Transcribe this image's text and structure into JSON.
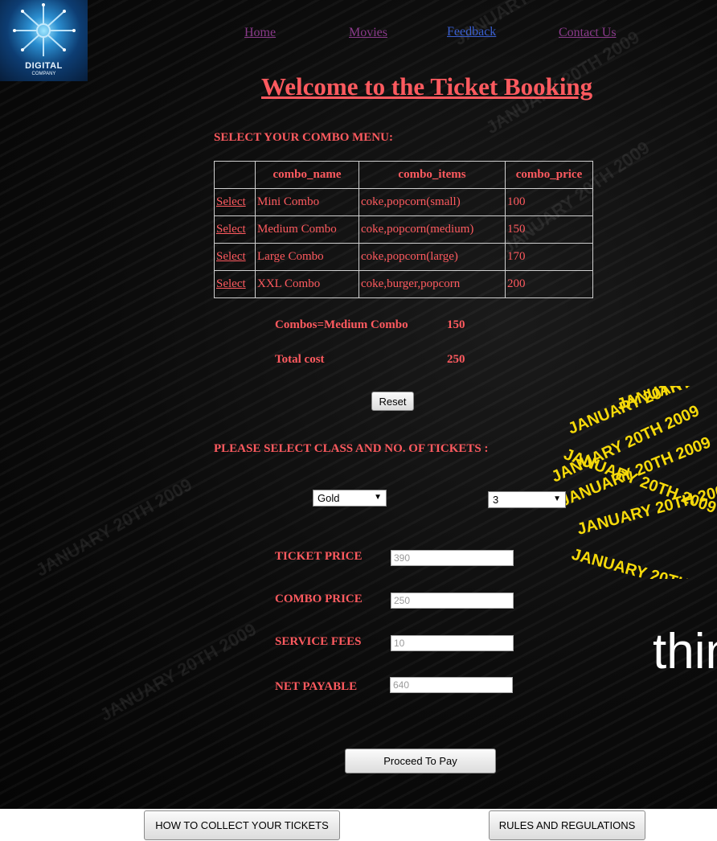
{
  "logo": {
    "title": "DIGITAL",
    "subtitle": "COMPANY"
  },
  "nav": {
    "items": [
      {
        "label": "Home",
        "color": "#8a3a8a"
      },
      {
        "label": "Movies",
        "color": "#8a3a8a"
      },
      {
        "label": "Feedback",
        "color": "#3a5fd0"
      },
      {
        "label": "Contact Us",
        "color": "#8a3a8a"
      }
    ]
  },
  "page_title": "Welcome to the Ticket Booking",
  "combo_section": {
    "heading": "SELECT YOUR COMBO MENU:",
    "columns": [
      "",
      "combo_name",
      "combo_items",
      "combo_price"
    ],
    "rows": [
      {
        "action": "Select",
        "name": "Mini Combo",
        "items": "coke,popcorn(small)",
        "price": "100"
      },
      {
        "action": "Select",
        "name": "Medium Combo",
        "items": "coke,popcorn(medium)",
        "price": "150"
      },
      {
        "action": "Select",
        "name": "Large Combo",
        "items": "coke,popcorn(large)",
        "price": "170"
      },
      {
        "action": "Select",
        "name": "XXL Combo",
        "items": "coke,burger,popcorn",
        "price": "200"
      }
    ]
  },
  "summary": {
    "combos_label": "Combos=Medium Combo",
    "combos_value": "150",
    "total_label": "Total cost",
    "total_value": "250",
    "reset_label": "Reset"
  },
  "ticket_section": {
    "heading": "PLEASE SELECT CLASS AND NO. OF TICKETS :",
    "class_selected": "Gold",
    "count_selected": "3"
  },
  "pricing": {
    "ticket_price_label": "TICKET PRICE",
    "ticket_price_value": "390",
    "combo_price_label": "COMBO PRICE",
    "combo_price_value": "250",
    "service_fees_label": "SERVICE FEES",
    "service_fees_value": "10",
    "net_payable_label": "NET PAYABLE",
    "net_payable_value": "640"
  },
  "proceed_label": "Proceed To Pay",
  "footer": {
    "collect_label": "HOW TO COLLECT YOUR TICKETS",
    "rules_label": "RULES AND REGULATIONS"
  },
  "background": {
    "pattern_text": "JANUARY 20TH 2009",
    "big_word": "thin",
    "accent": "#ff5a5f",
    "highlight": "#f5d90a"
  }
}
